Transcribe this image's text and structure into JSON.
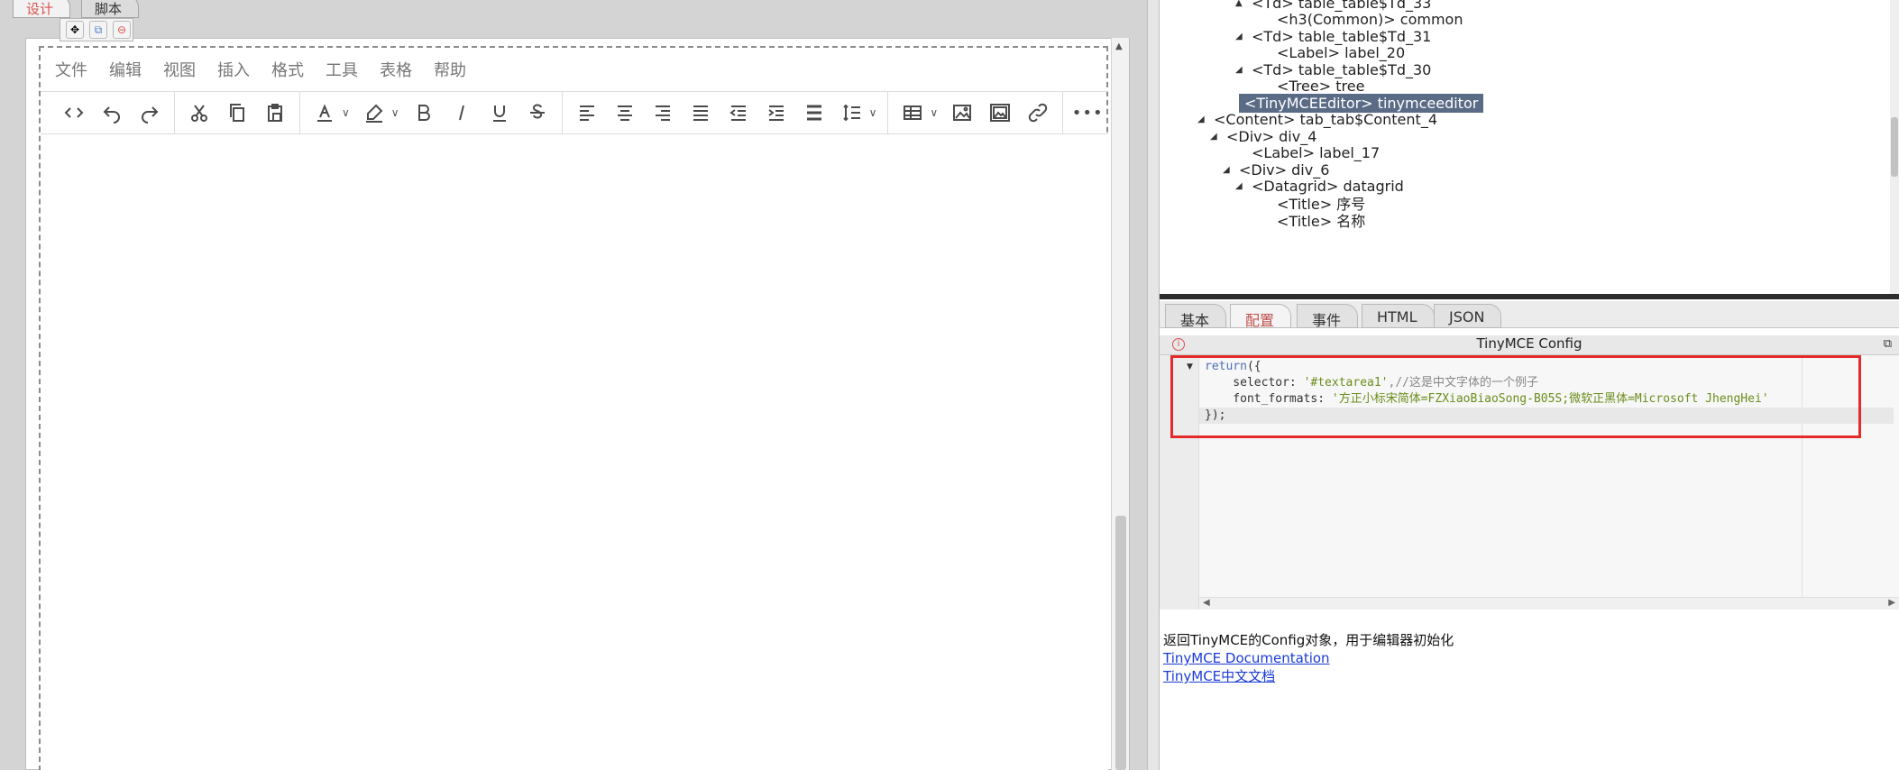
{
  "doc_tabs": [
    {
      "label": "设计",
      "active": true
    },
    {
      "label": "脚本",
      "active": false
    }
  ],
  "editor": {
    "menu": [
      "文件",
      "编辑",
      "视图",
      "插入",
      "格式",
      "工具",
      "表格",
      "帮助"
    ],
    "toolbar_icons": [
      [
        "source-code-icon",
        "undo-icon",
        "redo-icon"
      ],
      [
        "cut-icon",
        "copy-icon",
        "paste-icon"
      ],
      [
        "text-color-icon",
        "highlight-color-icon",
        "bold-icon",
        "italic-icon",
        "underline-icon",
        "strikethrough-icon"
      ],
      [
        "align-left-icon",
        "align-center-icon",
        "align-right-icon",
        "justify-icon",
        "outdent-icon",
        "indent-icon",
        "bullet-list-icon",
        "line-height-icon"
      ],
      [
        "table-icon",
        "image-icon",
        "media-icon",
        "link-icon"
      ],
      [
        "more-icon"
      ]
    ]
  },
  "tree": {
    "items": [
      {
        "indent": 6,
        "tri": "▲",
        "text": "<Td> table_table$Td_33"
      },
      {
        "indent": 8,
        "tri": "",
        "text": "<h3(Common)> common"
      },
      {
        "indent": 6,
        "tri": "◢",
        "text": "<Td> table_table$Td_31"
      },
      {
        "indent": 8,
        "tri": "",
        "text": "<Label> label_20"
      },
      {
        "indent": 6,
        "tri": "◢",
        "text": "<Td> table_table$Td_30"
      },
      {
        "indent": 8,
        "tri": "",
        "text": "<Tree> tree"
      },
      {
        "indent": 5,
        "tri": "",
        "text": "<TinyMCEEditor> tinymceeditor",
        "selected": true
      },
      {
        "indent": 3,
        "tri": "◢",
        "text": "<Content> tab_tab$Content_4"
      },
      {
        "indent": 4,
        "tri": "◢",
        "text": "<Div> div_4"
      },
      {
        "indent": 6,
        "tri": "",
        "text": "<Label> label_17"
      },
      {
        "indent": 5,
        "tri": "◢",
        "text": "<Div> div_6"
      },
      {
        "indent": 6,
        "tri": "◢",
        "text": "<Datagrid> datagrid"
      },
      {
        "indent": 8,
        "tri": "",
        "text": "<Title> 序号"
      },
      {
        "indent": 8,
        "tri": "",
        "text": "<Title> 名称"
      }
    ]
  },
  "prop_tabs": [
    {
      "label": "基本",
      "active": false
    },
    {
      "label": "配置",
      "active": true
    },
    {
      "label": "事件",
      "active": false
    },
    {
      "label": "HTML",
      "active": false
    },
    {
      "label": "JSON",
      "active": false
    }
  ],
  "config": {
    "title": "TinyMCE Config",
    "code": [
      {
        "parts": [
          {
            "t": "return",
            "c": "kw"
          },
          {
            "t": "({",
            "c": ""
          }
        ]
      },
      {
        "parts": [
          {
            "t": "    selector: ",
            "c": ""
          },
          {
            "t": "'#textarea1'",
            "c": "str"
          },
          {
            "t": ",//这是中文字体的一个例子",
            "c": "cm"
          }
        ]
      },
      {
        "parts": [
          {
            "t": "    font_formats: ",
            "c": ""
          },
          {
            "t": "'方正小标宋简体=FZXiaoBiaoSong-B05S;微软正黑体=Microsoft JhengHei'",
            "c": "str"
          }
        ]
      },
      {
        "parts": [
          {
            "t": "});",
            "c": ""
          }
        ],
        "hl": true
      }
    ]
  },
  "help": {
    "description": "返回TinyMCE的Config对象，用于编辑器初始化",
    "links": [
      "TinyMCE Documentation",
      "TinyMCE中文文档"
    ]
  }
}
